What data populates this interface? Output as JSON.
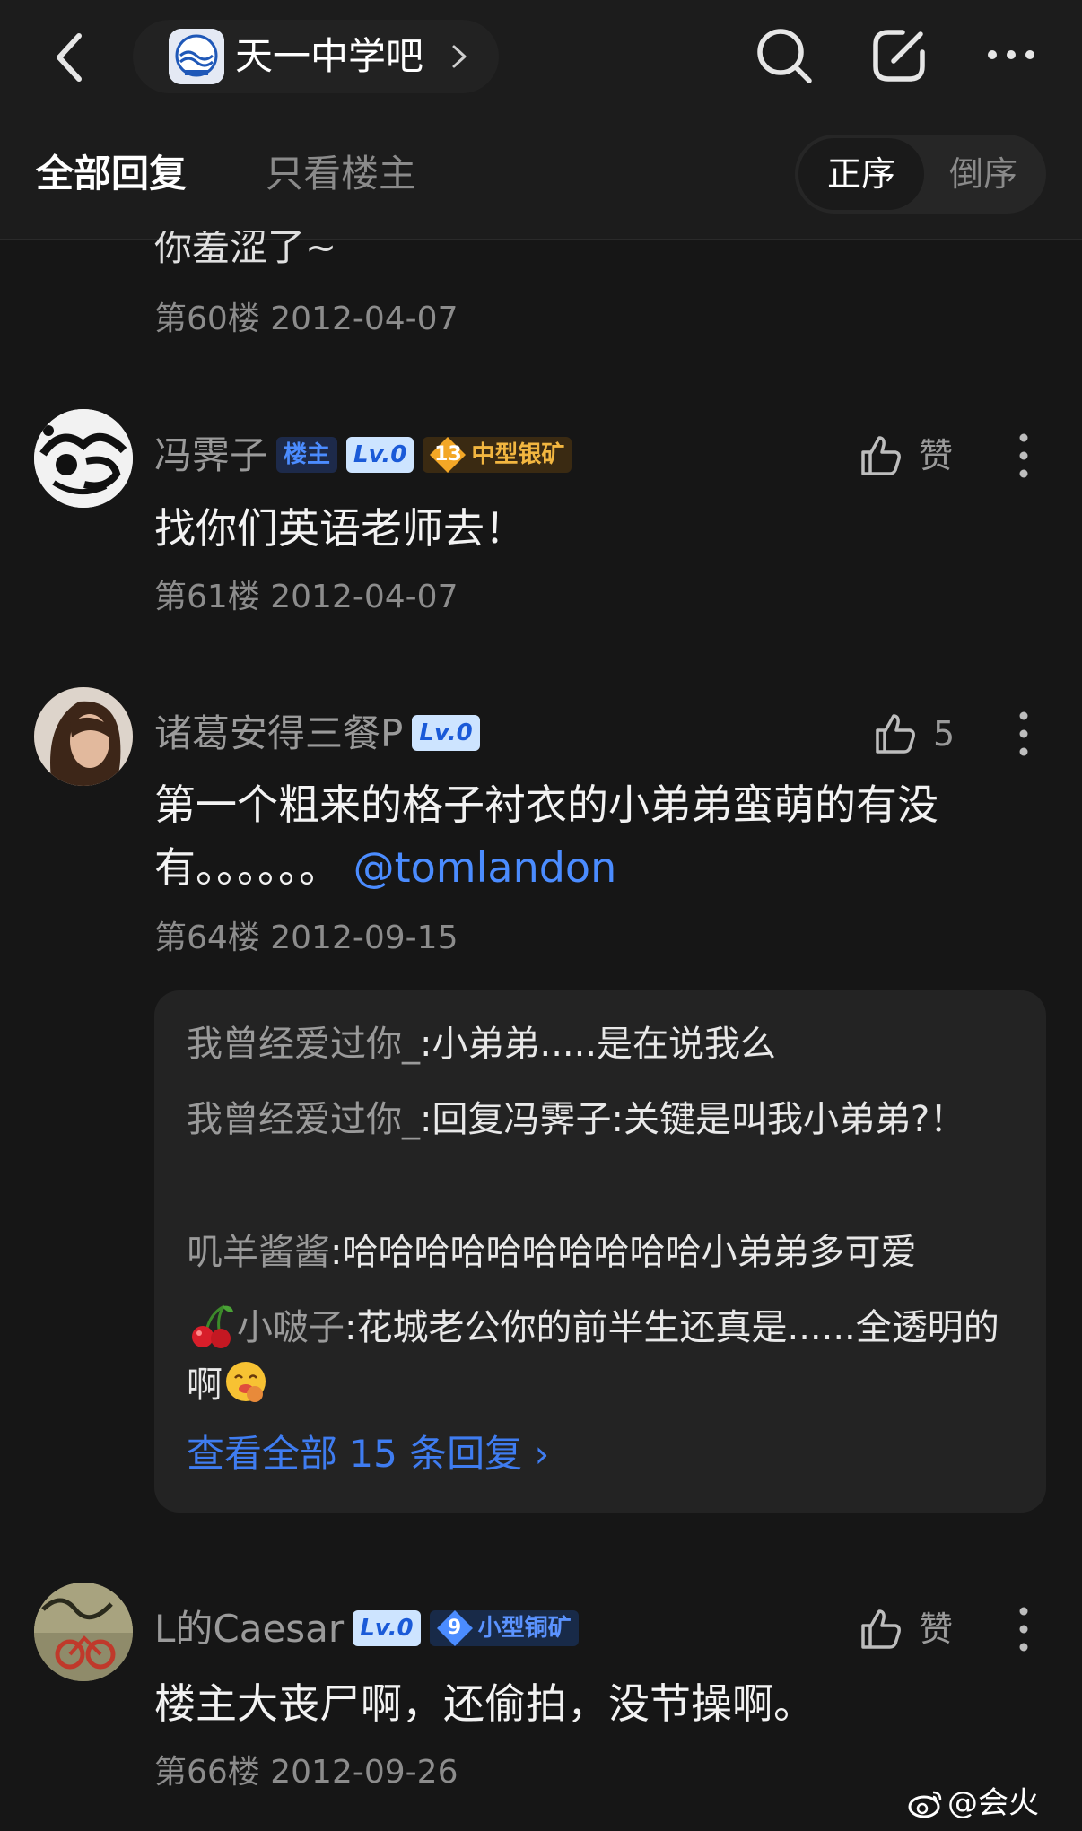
{
  "header": {
    "forum_name": "天一中学吧",
    "icons": [
      "back-icon",
      "forum-logo",
      "chevron-right-icon",
      "search-icon",
      "compose-icon",
      "more-icon"
    ]
  },
  "tabs": {
    "all_label": "全部回复",
    "op_only_label": "只看楼主",
    "sort_asc": "正序",
    "sort_desc": "倒序",
    "active_sort": "正序"
  },
  "cutoff_post": {
    "partial_text": "你羞涩了~",
    "meta": "第60楼 2012-04-07"
  },
  "posts": [
    {
      "author": "冯霁子",
      "badges": {
        "op": "楼主",
        "level": "Lv.0",
        "rank_num": "13",
        "rank_label": "中型银矿"
      },
      "like_label": "赞",
      "content": "找你们英语老师去！",
      "meta": "第61楼 2012-04-07"
    },
    {
      "author": "诸葛安得三餐P",
      "badges": {
        "level": "Lv.0"
      },
      "like_label": "5",
      "content_text": "第一个粗来的格子衬衣的小弟弟蛮萌的有没有。。。。。。",
      "mention": "@tomlandon",
      "meta": "第64楼 2012-09-15",
      "replies": [
        {
          "name": "我曾经爱过你_",
          "text": ":小弟弟.....是在说我么"
        },
        {
          "name": "我曾经爱过你_",
          "text": ":回复冯霁子:关键是叫我小弟弟?！"
        },
        {
          "name": "叽羊酱酱",
          "text": ":哈哈哈哈哈哈哈哈哈哈小弟弟多可爱"
        },
        {
          "name": "小啵子",
          "text": ":花城老公你的前半生还真是......全透明的啊"
        }
      ],
      "view_all": "查看全部 15 条回复 ›"
    },
    {
      "author": "L的Caesar",
      "badges": {
        "level": "Lv.0",
        "rank_num": "9",
        "rank_label": "小型铜矿"
      },
      "like_label": "赞",
      "content": "楼主大丧尸啊，还偷拍，没节操啊。",
      "meta": "第66楼 2012-09-26"
    }
  ],
  "watermark": "@会火",
  "colors": {
    "background": "#161616",
    "accent_blue": "#4b8cff",
    "link_blue": "#3f7cf0",
    "silver_badge_text": "#f2b640"
  }
}
